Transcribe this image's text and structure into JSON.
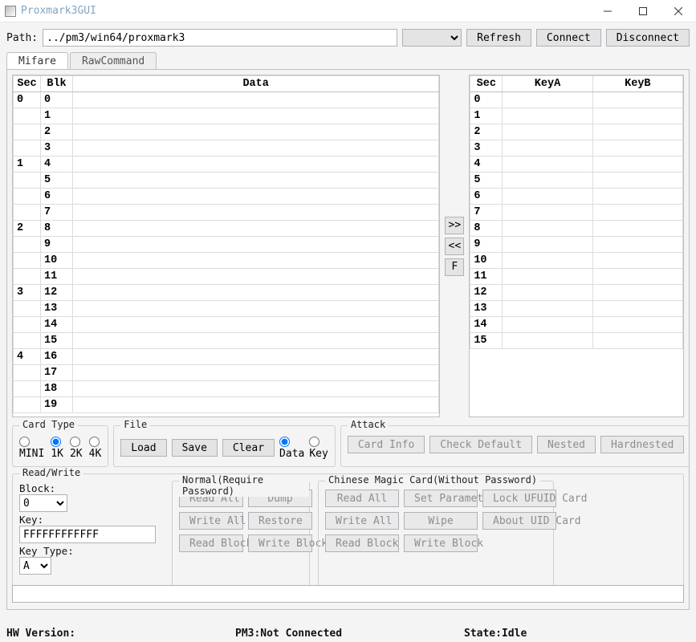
{
  "window": {
    "title": "Proxmark3GUI"
  },
  "toolbar": {
    "path_label": "Path:",
    "path_value": "../pm3/win64/proxmark3",
    "refresh": "Refresh",
    "connect": "Connect",
    "disconnect": "Disconnect"
  },
  "tabs": {
    "mifare": "Mifare",
    "raw": "RawCommand"
  },
  "data_table": {
    "headers": {
      "sec": "Sec",
      "blk": "Blk",
      "data": "Data"
    },
    "rows": [
      {
        "sec": "0",
        "blk": "0"
      },
      {
        "sec": "",
        "blk": "1"
      },
      {
        "sec": "",
        "blk": "2"
      },
      {
        "sec": "",
        "blk": "3"
      },
      {
        "sec": "1",
        "blk": "4"
      },
      {
        "sec": "",
        "blk": "5"
      },
      {
        "sec": "",
        "blk": "6"
      },
      {
        "sec": "",
        "blk": "7"
      },
      {
        "sec": "2",
        "blk": "8"
      },
      {
        "sec": "",
        "blk": "9"
      },
      {
        "sec": "",
        "blk": "10"
      },
      {
        "sec": "",
        "blk": "11"
      },
      {
        "sec": "3",
        "blk": "12"
      },
      {
        "sec": "",
        "blk": "13"
      },
      {
        "sec": "",
        "blk": "14"
      },
      {
        "sec": "",
        "blk": "15"
      },
      {
        "sec": "4",
        "blk": "16"
      },
      {
        "sec": "",
        "blk": "17"
      },
      {
        "sec": "",
        "blk": "18"
      },
      {
        "sec": "",
        "blk": "19"
      }
    ]
  },
  "key_table": {
    "headers": {
      "sec": "Sec",
      "keya": "KeyA",
      "keyb": "KeyB"
    },
    "rows": [
      {
        "sec": "0"
      },
      {
        "sec": "1"
      },
      {
        "sec": "2"
      },
      {
        "sec": "3"
      },
      {
        "sec": "4"
      },
      {
        "sec": "5"
      },
      {
        "sec": "6"
      },
      {
        "sec": "7"
      },
      {
        "sec": "8"
      },
      {
        "sec": "9"
      },
      {
        "sec": "10"
      },
      {
        "sec": "11"
      },
      {
        "sec": "12"
      },
      {
        "sec": "13"
      },
      {
        "sec": "14"
      },
      {
        "sec": "15"
      }
    ]
  },
  "midbtns": {
    "right": ">>",
    "left": "<<",
    "f": "F"
  },
  "card_type": {
    "label": "Card Type",
    "mini": "MINI",
    "k1": "1K",
    "k2": "2K",
    "k4": "4K"
  },
  "file": {
    "label": "File",
    "load": "Load",
    "save": "Save",
    "clear": "Clear",
    "data": "Data",
    "key": "Key"
  },
  "attack": {
    "label": "Attack",
    "card_info": "Card Info",
    "check_default": "Check Default",
    "nested": "Nested",
    "hardnested": "Hardnested"
  },
  "rw": {
    "label": "Read/Write",
    "block_label": "Block:",
    "block_value": "0",
    "key_label": "Key:",
    "key_value": "FFFFFFFFFFFF",
    "keytype_label": "Key Type:",
    "keytype_value": "A",
    "normal": {
      "label": "Normal(Require Password)",
      "read_all": "Read All",
      "dump": "Dump",
      "write_all": "Write All",
      "restore": "Restore",
      "read_block": "Read Block",
      "write_block": "Write Block"
    },
    "magic": {
      "label": "Chinese Magic Card(Without Password)",
      "read_all": "Read All",
      "set_param": "Set Parameter",
      "lock_ufuid": "Lock UFUID Card",
      "write_all": "Write All",
      "wipe": "Wipe",
      "about_uid": "About UID Card",
      "read_block": "Read Block",
      "write_block": "Write Block"
    }
  },
  "status": {
    "hw": "HW Version:",
    "pm3": "PM3:Not Connected",
    "state": "State:Idle"
  }
}
